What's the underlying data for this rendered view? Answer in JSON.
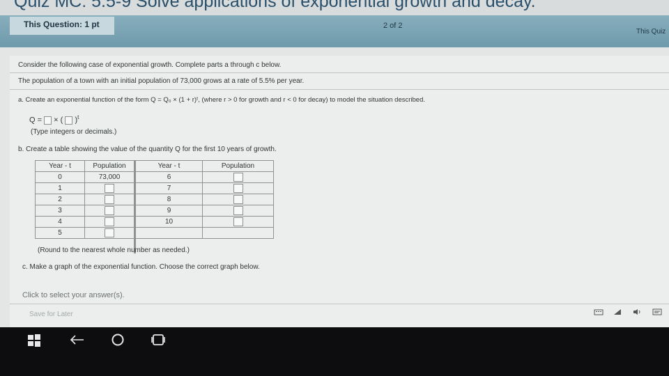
{
  "header": {
    "title": "Quiz MC: 5.5-9 Solve applications of exponential growth and decay.",
    "points": "This Question: 1 pt",
    "page_count": "2 of 2",
    "quiz_label": "This Quiz"
  },
  "question": {
    "intro": "Consider the following case of exponential growth. Complete parts a through c below.",
    "statement": "The population of a town with an initial population of 73,000 grows at a rate of 5.5% per year.",
    "part_a": "a. Create an exponential function of the form Q = Q₀ × (1 + r)ᵗ, (where r > 0 for growth and r < 0 for decay) to model the situation described.",
    "formula_lhs": "Q =",
    "formula_times": "×",
    "formula_exp": "t",
    "hint_a": "(Type integers or decimals.)",
    "part_b": "b. Create a table showing the value of the quantity Q for the first 10 years of growth.",
    "table": {
      "headers": [
        "Year - t",
        "Population",
        "Year - t",
        "Population"
      ],
      "left_rows": [
        {
          "year": "0",
          "population": "73,000"
        },
        {
          "year": "1",
          "population": ""
        },
        {
          "year": "2",
          "population": ""
        },
        {
          "year": "3",
          "population": ""
        },
        {
          "year": "4",
          "population": ""
        },
        {
          "year": "5",
          "population": ""
        }
      ],
      "right_rows": [
        {
          "year": "6",
          "population": ""
        },
        {
          "year": "7",
          "population": ""
        },
        {
          "year": "8",
          "population": ""
        },
        {
          "year": "9",
          "population": ""
        },
        {
          "year": "10",
          "population": ""
        }
      ]
    },
    "hint_b": "(Round to the nearest whole number as needed.)",
    "part_c": "c. Make a graph of the exponential function. Choose the correct graph below.",
    "select_prompt": "Click to select your answer(s).",
    "save_label": "Save for Later"
  },
  "taskbar": {
    "icons": [
      "windows-logo-icon",
      "back-arrow-icon",
      "home-circle-icon",
      "recent-apps-icon"
    ],
    "tray_icons": [
      "keyboard-icon",
      "wifi-icon",
      "volume-icon",
      "message-icon"
    ]
  }
}
